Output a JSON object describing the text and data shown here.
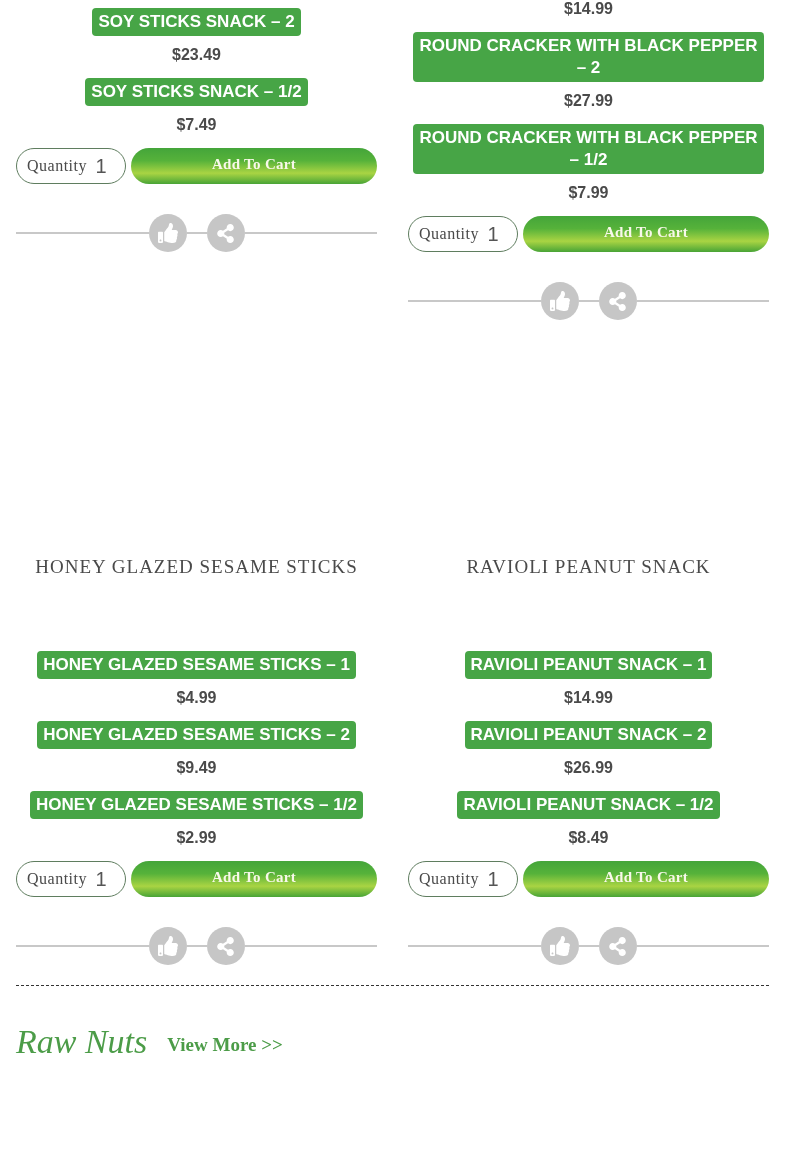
{
  "product_rows": [
    {
      "products": [
        {
          "variants": [
            {
              "name": "SOY STICKS SNACK – 2",
              "price": "$23.49"
            },
            {
              "name": "SOY STICKS SNACK – 1/2",
              "price": "$7.49"
            }
          ],
          "quantity": {
            "label": "Quantity",
            "value": "1"
          },
          "add_to_cart": "Add To Cart"
        },
        {
          "variants": [
            {
              "price": "$14.99"
            },
            {
              "name": "ROUND CRACKER WITH BLACK PEPPER – 2",
              "price": "$27.99"
            },
            {
              "name": "ROUND CRACKER WITH BLACK PEPPER – 1/2",
              "price": "$7.99"
            }
          ],
          "quantity": {
            "label": "Quantity",
            "value": "1"
          },
          "add_to_cart": "Add To Cart"
        }
      ]
    },
    {
      "products": [
        {
          "title": "HONEY GLAZED SESAME STICKS",
          "variants": [
            {
              "name": "HONEY GLAZED SESAME STICKS – 1",
              "price": "$4.99"
            },
            {
              "name": "HONEY GLAZED SESAME STICKS – 2",
              "price": "$9.49"
            },
            {
              "name": "HONEY GLAZED SESAME STICKS – 1/2",
              "price": "$2.99"
            }
          ],
          "quantity": {
            "label": "Quantity",
            "value": "1"
          },
          "add_to_cart": "Add To Cart"
        },
        {
          "title": "RAVIOLI PEANUT SNACK",
          "variants": [
            {
              "name": "RAVIOLI PEANUT SNACK – 1",
              "price": "$14.99"
            },
            {
              "name": "RAVIOLI PEANUT SNACK – 2",
              "price": "$26.99"
            },
            {
              "name": "RAVIOLI PEANUT SNACK – 1/2",
              "price": "$8.49"
            }
          ],
          "quantity": {
            "label": "Quantity",
            "value": "1"
          },
          "add_to_cart": "Add To Cart"
        }
      ]
    }
  ],
  "next_section": {
    "title": "Raw Nuts",
    "link": "View More >>"
  }
}
